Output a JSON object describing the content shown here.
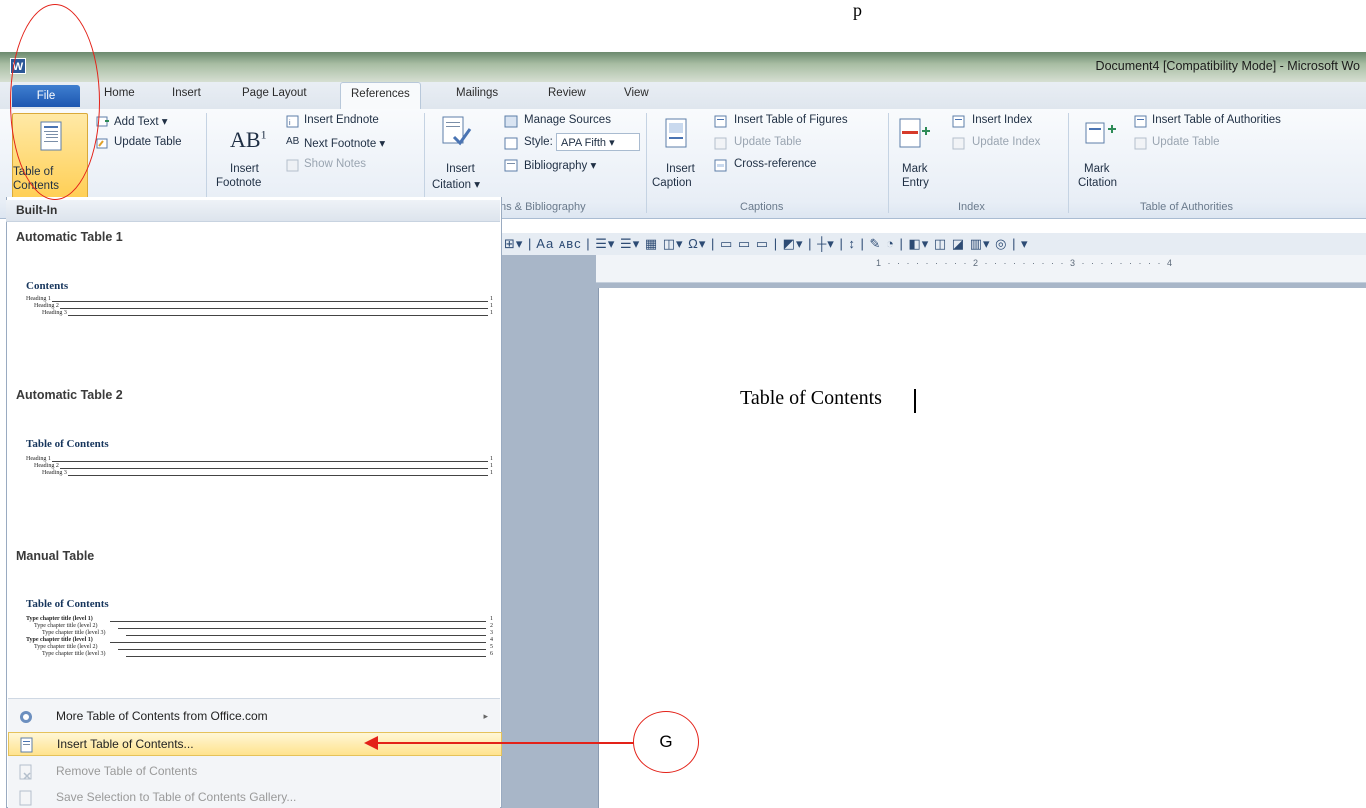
{
  "window": {
    "title": "Document4 [Compatibility Mode] - Microsoft Wo",
    "app_icon_letter": "W",
    "stray_glyph": "p"
  },
  "tabs": [
    "File",
    "Home",
    "Insert",
    "Page Layout",
    "References",
    "Mailings",
    "Review",
    "View"
  ],
  "active_tab": "References",
  "ribbon": {
    "toc": {
      "button_line1": "Table of",
      "button_line2": "Contents",
      "add_text": "Add Text",
      "update_table": "Update Table"
    },
    "footnotes": {
      "insert_footnote_line1": "Insert",
      "insert_footnote_line2": "Footnote",
      "insert_endnote": "Insert Endnote",
      "next_footnote": "Next Footnote",
      "show_notes": "Show Notes"
    },
    "citations": {
      "insert_citation_line1": "Insert",
      "insert_citation_line2": "Citation",
      "manage_sources": "Manage Sources",
      "style_label": "Style:",
      "style_value": "APA Fifth",
      "bibliography": "Bibliography",
      "group_label": "ns & Bibliography"
    },
    "captions": {
      "insert_caption_line1": "Insert",
      "insert_caption_line2": "Caption",
      "insert_table_of_figures": "Insert Table of Figures",
      "update_table": "Update Table",
      "cross_reference": "Cross-reference",
      "group_label": "Captions"
    },
    "index": {
      "mark_entry_line1": "Mark",
      "mark_entry_line2": "Entry",
      "insert_index": "Insert Index",
      "update_index": "Update Index",
      "group_label": "Index"
    },
    "authorities": {
      "mark_citation_line1": "Mark",
      "mark_citation_line2": "Citation",
      "insert_table_of_authorities": "Insert Table of Authorities",
      "update_table": "Update Table",
      "group_label": "Table of Authorities"
    }
  },
  "gallery": {
    "section_label": "Built-In",
    "items": [
      {
        "heading": "Automatic Table 1",
        "preview_title": "Contents",
        "lines": [
          "Heading 1",
          "Heading 2",
          "Heading 3"
        ],
        "page": "1"
      },
      {
        "heading": "Automatic Table 2",
        "preview_title": "Table of Contents",
        "lines": [
          "Heading 1",
          "Heading 2",
          "Heading 3"
        ],
        "page": "1"
      },
      {
        "heading": "Manual Table",
        "preview_title": "Table of Contents",
        "lines": [
          "Type chapter title (level 1)",
          "Type chapter title (level 2)",
          "Type chapter title (level 3)",
          "Type chapter title (level 1)",
          "Type chapter title (level 2)",
          "Type chapter title (level 3)"
        ],
        "pages": [
          "1",
          "2",
          "3",
          "4",
          "5",
          "6"
        ]
      }
    ]
  },
  "menu": [
    {
      "label": "More Table of Contents from Office.com",
      "state": "normal",
      "has_submenu": true
    },
    {
      "label": "Insert Table of Contents...",
      "state": "highlighted",
      "has_submenu": false
    },
    {
      "label": "Remove Table of Contents",
      "state": "disabled",
      "has_submenu": false
    },
    {
      "label": "Save Selection to Table of Contents Gallery...",
      "state": "disabled",
      "has_submenu": false
    }
  ],
  "document": {
    "body_text": "Table of Contents",
    "ruler_marks": "1 · · · · · · · · · 2 · · · · · · · · · 3 · · · · · · · · · 4"
  },
  "annotations": {
    "callout_label": "G",
    "annotation_color": "#e32219"
  }
}
